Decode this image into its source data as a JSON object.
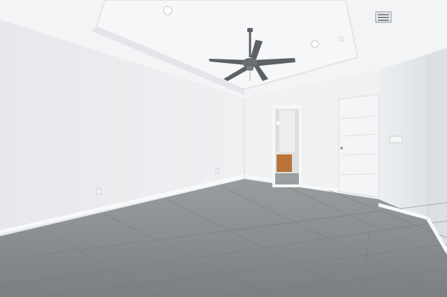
{
  "scene": {
    "type": "photo",
    "subject": "empty-room-interior",
    "palette": {
      "wall_left": "#e9ebee",
      "wall_back": "#eff1f3",
      "wall_right": "#e4e7ea",
      "ceiling": "#f3f4f6",
      "floor": "#8c8f91",
      "floor_dark": "#6f7274",
      "grout": "#7b7e80",
      "door": "#f4f5f6",
      "vanity": "#b8743a",
      "fan": "#5c5f63"
    }
  }
}
